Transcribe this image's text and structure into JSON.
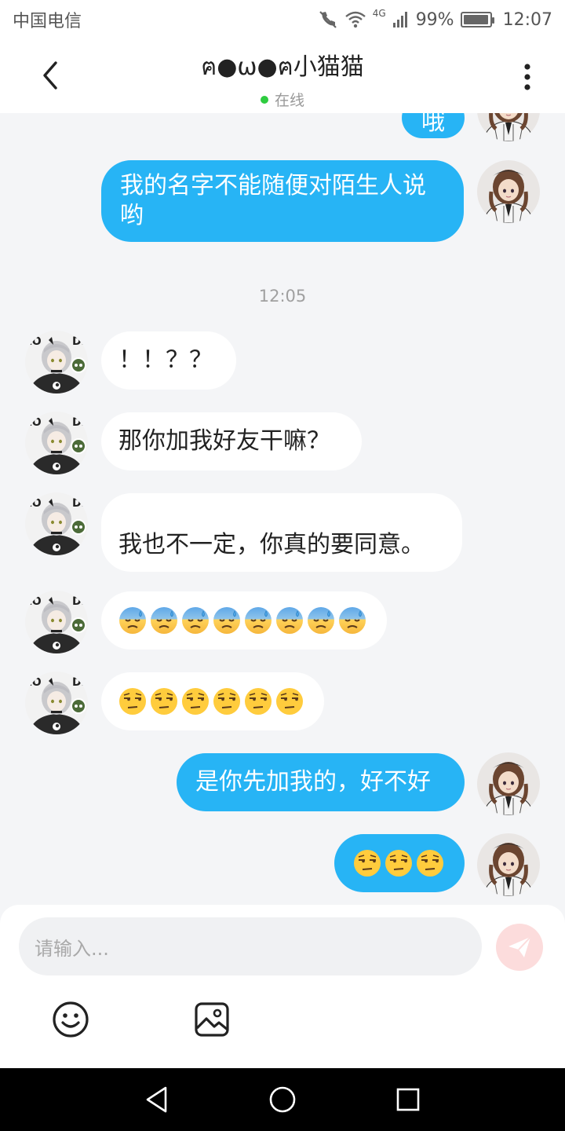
{
  "status_bar": {
    "carrier": "中国电信",
    "network": "4G",
    "battery_percent_label": "99%",
    "battery_level": 0.99,
    "time": "12:07",
    "icons": [
      "call-off-icon",
      "wifi-icon",
      "signal-icon",
      "battery-icon"
    ]
  },
  "header": {
    "title": "ฅ●ω●ฅ小猫猫",
    "presence": "在线",
    "back_icon": "chevron-left-icon",
    "more_icon": "more-vertical-icon"
  },
  "messages": [
    {
      "side": "out",
      "text": "哦",
      "partial": true
    },
    {
      "side": "out",
      "text": "我的名字不能随便对陌生人说哟"
    },
    {
      "type": "time",
      "text": "12:05"
    },
    {
      "side": "in",
      "text": "！！？？"
    },
    {
      "side": "in",
      "text": "那你加我好友干嘛？"
    },
    {
      "side": "in",
      "text": "我也不一定，你真的要同意。"
    },
    {
      "side": "in",
      "emoji": "anxious-sweat-face",
      "count": 8
    },
    {
      "side": "in",
      "emoji": "unamused-face",
      "count": 6
    },
    {
      "side": "out",
      "text": "是你先加我的，好不好"
    },
    {
      "side": "out",
      "emoji": "unamused-face",
      "count": 3
    }
  ],
  "input": {
    "placeholder": "请输入..."
  },
  "toolbar": {
    "emoji_icon": "smiley-icon",
    "image_icon": "image-icon",
    "send_icon": "send-icon"
  },
  "colors": {
    "outgoing_bubble": "#27b4f5",
    "incoming_bubble": "#ffffff",
    "background": "#f4f5f7",
    "online_dot": "#2ecc40",
    "send_button": "#fcdcdc"
  },
  "nav": [
    "back-triangle-icon",
    "home-circle-icon",
    "recents-square-icon"
  ]
}
